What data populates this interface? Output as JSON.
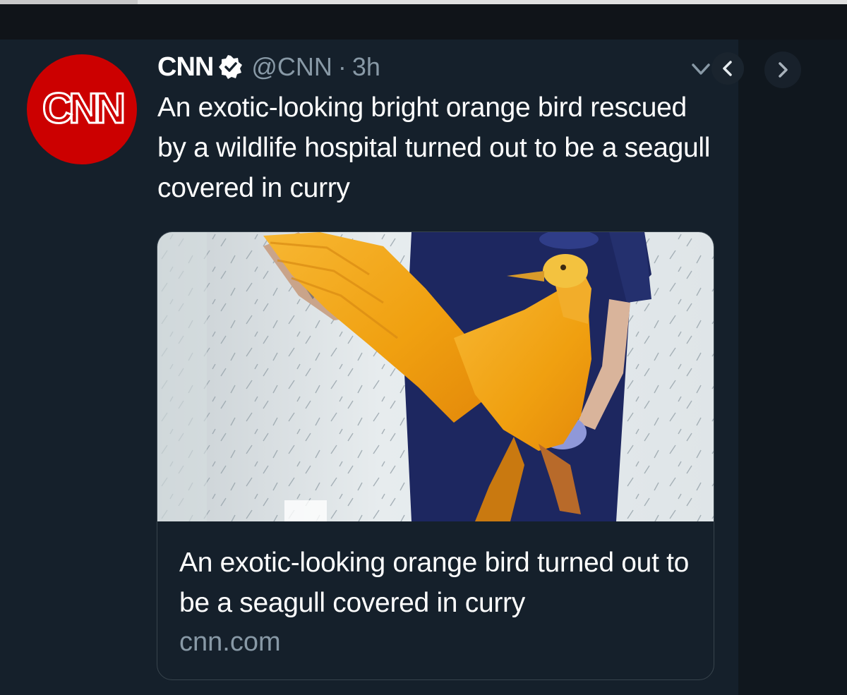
{
  "tweet": {
    "author_name": "CNN",
    "handle": "@CNN",
    "separator": "·",
    "time": "3h",
    "avatar_logo": "CNN",
    "text": "An exotic-looking bright orange bird rescued by a wildlife hospital turned out to be a seagull covered in curry"
  },
  "card": {
    "title": "An exotic-looking orange bird turned out to be a seagull covered in curry",
    "domain": "cnn.com"
  },
  "icons": {
    "verified": "verified-badge-icon",
    "caret": "chevron-down-icon",
    "prev": "chevron-left-icon",
    "next": "chevron-right-icon"
  },
  "colors": {
    "background": "#15202b",
    "avatar_red": "#cc0000",
    "secondary_text": "#8899a6",
    "bird_orange": "#f0a010"
  }
}
